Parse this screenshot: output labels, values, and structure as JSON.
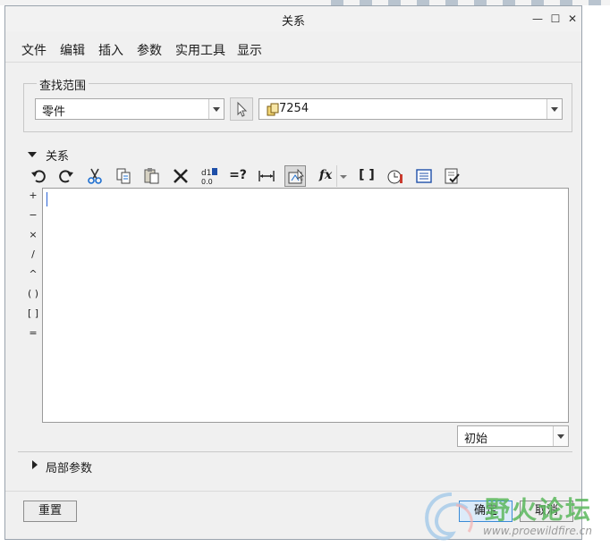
{
  "window": {
    "title": "关系"
  },
  "menu": [
    "文件",
    "编辑",
    "插入",
    "参数",
    "实用工具",
    "显示"
  ],
  "lookup": {
    "legend": "查找范围",
    "scope_value": "零件",
    "model_value": "7254"
  },
  "relations": {
    "header": "关系",
    "operators": [
      "+",
      "−",
      "×",
      "/",
      "^",
      "( )",
      "[ ]",
      "="
    ],
    "toolbar_icons": [
      "undo-icon",
      "redo-icon",
      "cut-icon",
      "copy-icon",
      "paste-icon",
      "delete-icon",
      "show-values-icon",
      "evaluate-icon",
      "dimension-icon",
      "select-dimension-icon",
      "function-icon",
      "brackets-icon",
      "verify-icon",
      "sort-icon",
      "check-icon"
    ],
    "toolbar_labels": {
      "evaluate": "=?",
      "function": "fx",
      "brackets": "[ ]"
    },
    "text": "",
    "sort_value": "初始"
  },
  "local_params": {
    "header": "局部参数"
  },
  "buttons": {
    "reset": "重置",
    "ok": "确定",
    "cancel": "取消"
  },
  "watermark": {
    "title": "野火论坛",
    "url": "www.proewildfire.cn"
  }
}
